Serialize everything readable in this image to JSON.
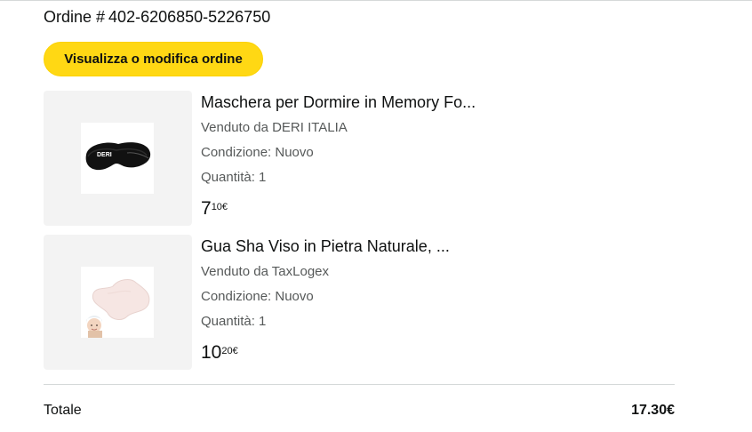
{
  "order": {
    "label": "Ordine #",
    "number": "402-6206850-5226750"
  },
  "actions": {
    "view_edit_label": "Visualizza o modifica ordine"
  },
  "items": [
    {
      "title": "Maschera per Dormire in Memory Fo...",
      "seller": "Venduto da DERI ITALIA",
      "condition": "Condizione: Nuovo",
      "quantity": "Quantità: 1",
      "price_whole": "7",
      "price_fraction": "10€",
      "image_icon": "sleep-mask-image",
      "image_text": "DERI"
    },
    {
      "title": "Gua Sha Viso in Pietra Naturale, ...",
      "seller": "Venduto da TaxLogex",
      "condition": "Condizione: Nuovo",
      "quantity": "Quantità: 1",
      "price_whole": "10",
      "price_fraction": "20€",
      "image_icon": "gua-sha-image"
    }
  ],
  "summary": {
    "total_label": "Totale",
    "total_value": "17.30€"
  },
  "colors": {
    "button_bg": "#ffd814",
    "thumb_bg": "#f3f3f3",
    "secondary_text": "#565959",
    "primary_text": "#0f1111"
  }
}
